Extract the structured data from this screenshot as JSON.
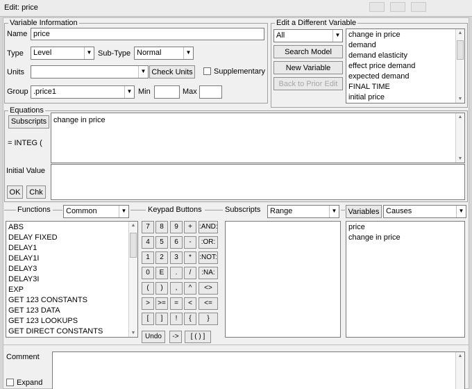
{
  "window": {
    "title": "Edit: price"
  },
  "variable_info": {
    "legend": "Variable Information",
    "name_label": "Name",
    "name_value": "price",
    "type_label": "Type",
    "type_value": "Level",
    "subtype_label": "Sub-Type",
    "subtype_value": "Normal",
    "units_label": "Units",
    "units_value": "",
    "check_units_label": "Check Units",
    "supplementary_label": "Supplementary",
    "group_label": "Group",
    "group_value": ".price1",
    "min_label": "Min",
    "min_value": "",
    "max_label": "Max",
    "max_value": ""
  },
  "edit_different": {
    "legend": "Edit a Different Variable",
    "filter_value": "All",
    "search_model_label": "Search Model",
    "new_variable_label": "New Variable",
    "back_label": "Back to Prior Edit",
    "variables": [
      "change in price",
      "demand",
      "demand elasticity",
      "effect price demand",
      "expected demand",
      "FINAL TIME",
      "initial price"
    ]
  },
  "equations": {
    "legend": "Equations",
    "subscripts_label": "Subscripts",
    "integ_label": "= INTEG  (",
    "equation_text": "change in price",
    "initial_value_label": "Initial Value",
    "initial_value": "",
    "ok_label": "OK",
    "chk_label": "Chk"
  },
  "functions": {
    "label": "Functions",
    "filter_value": "Common",
    "items": [
      "ABS",
      "DELAY FIXED",
      "DELAY1",
      "DELAY1I",
      "DELAY3",
      "DELAY3I",
      "EXP",
      "GET 123 CONSTANTS",
      "GET 123 DATA",
      "GET 123 LOOKUPS",
      "GET DIRECT CONSTANTS"
    ]
  },
  "keypad": {
    "label": "Keypad Buttons",
    "rows": [
      [
        "7",
        "8",
        "9",
        "+",
        ":AND:"
      ],
      [
        "4",
        "5",
        "6",
        "-",
        ":OR:"
      ],
      [
        "1",
        "2",
        "3",
        "*",
        ":NOT:"
      ],
      [
        "0",
        "E",
        ".",
        "/",
        ":NA:"
      ],
      [
        "(",
        ")",
        ",",
        "^",
        "<>"
      ],
      [
        ">",
        ">=",
        "=",
        "<",
        "<="
      ],
      [
        "[",
        "]",
        "!",
        "{",
        "}"
      ]
    ],
    "bottom": [
      "Undo",
      "->",
      "[ ( ) ]"
    ]
  },
  "subscripts": {
    "label": "Subscripts",
    "filter_value": "Range"
  },
  "variables": {
    "label": "Variables",
    "filter_value": "Causes",
    "items": [
      "price",
      "change in price"
    ]
  },
  "comment": {
    "label": "Comment",
    "value": ""
  },
  "expand": {
    "label": "Expand"
  }
}
